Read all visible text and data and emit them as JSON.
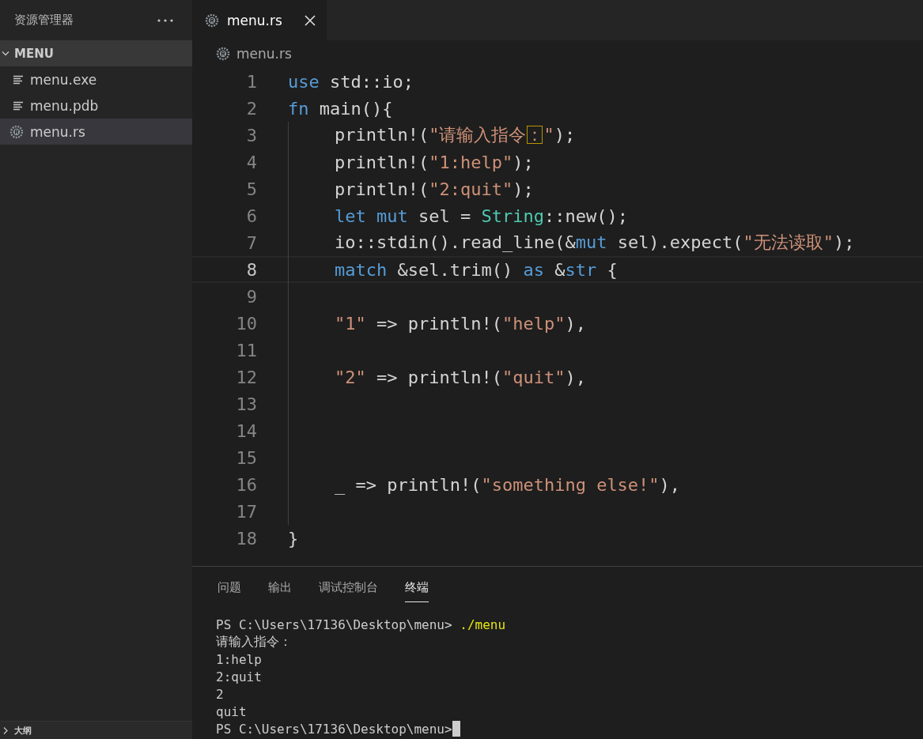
{
  "sidebar": {
    "title": "资源管理器",
    "folder": {
      "label": "MENU",
      "expanded": true
    },
    "files": [
      {
        "name": "menu.exe",
        "kind": "text",
        "selected": false
      },
      {
        "name": "menu.pdb",
        "kind": "text",
        "selected": false
      },
      {
        "name": "menu.rs",
        "kind": "rust",
        "selected": true
      }
    ],
    "outline": {
      "label": "大纲",
      "expanded": false
    }
  },
  "tabs": [
    {
      "label": "menu.rs",
      "kind": "rust",
      "selected": true
    }
  ],
  "breadcrumb": {
    "label": "menu.rs",
    "kind": "rust"
  },
  "code": [
    {
      "number": "1",
      "indented": false,
      "current": false,
      "tokens": [
        {
          "kind": "keyword",
          "text": "use"
        },
        {
          "kind": "plain",
          "text": " std::io;"
        }
      ]
    },
    {
      "number": "2",
      "indented": false,
      "current": false,
      "tokens": [
        {
          "kind": "keyword",
          "text": "fn"
        },
        {
          "kind": "plain",
          "text": " main(){"
        }
      ]
    },
    {
      "number": "3",
      "indented": true,
      "current": false,
      "tokens": [
        {
          "kind": "plain",
          "text": "println!("
        },
        {
          "kind": "string",
          "text": "\"请输入指令"
        },
        {
          "kind": "flagged",
          "text": "："
        },
        {
          "kind": "string",
          "text": "\""
        },
        {
          "kind": "plain",
          "text": ");"
        }
      ]
    },
    {
      "number": "4",
      "indented": true,
      "current": false,
      "tokens": [
        {
          "kind": "plain",
          "text": "println!("
        },
        {
          "kind": "string",
          "text": "\"1:help\""
        },
        {
          "kind": "plain",
          "text": ");"
        }
      ]
    },
    {
      "number": "5",
      "indented": true,
      "current": false,
      "tokens": [
        {
          "kind": "plain",
          "text": "println!("
        },
        {
          "kind": "string",
          "text": "\"2:quit\""
        },
        {
          "kind": "plain",
          "text": ");"
        }
      ]
    },
    {
      "number": "6",
      "indented": true,
      "current": false,
      "tokens": [
        {
          "kind": "keyword",
          "text": "let"
        },
        {
          "kind": "keyword",
          "text": " mut"
        },
        {
          "kind": "plain",
          "text": " sel = "
        },
        {
          "kind": "type",
          "text": "String"
        },
        {
          "kind": "plain",
          "text": "::new();"
        }
      ]
    },
    {
      "number": "7",
      "indented": true,
      "current": false,
      "tokens": [
        {
          "kind": "plain",
          "text": "io::stdin().read_line(&"
        },
        {
          "kind": "keyword",
          "text": "mut"
        },
        {
          "kind": "plain",
          "text": " sel).expect("
        },
        {
          "kind": "string",
          "text": "\"无法读取\""
        },
        {
          "kind": "plain",
          "text": ");"
        }
      ]
    },
    {
      "number": "8",
      "indented": true,
      "current": true,
      "tokens": [
        {
          "kind": "keyword",
          "text": "match"
        },
        {
          "kind": "plain",
          "text": " &sel.trim() "
        },
        {
          "kind": "keyword",
          "text": "as"
        },
        {
          "kind": "plain",
          "text": " &"
        },
        {
          "kind": "keyword",
          "text": "str"
        },
        {
          "kind": "plain",
          "text": " {"
        }
      ]
    },
    {
      "number": "9",
      "indented": true,
      "current": false
    },
    {
      "number": "10",
      "indented": true,
      "current": false,
      "tokens": [
        {
          "kind": "string",
          "text": "\"1\""
        },
        {
          "kind": "plain",
          "text": " => println!("
        },
        {
          "kind": "string",
          "text": "\"help\""
        },
        {
          "kind": "plain",
          "text": "),"
        }
      ]
    },
    {
      "number": "11",
      "indented": true,
      "current": false
    },
    {
      "number": "12",
      "indented": true,
      "current": false,
      "tokens": [
        {
          "kind": "string",
          "text": "\"2\""
        },
        {
          "kind": "plain",
          "text": " => println!("
        },
        {
          "kind": "string",
          "text": "\"quit\""
        },
        {
          "kind": "plain",
          "text": "),"
        }
      ]
    },
    {
      "number": "13",
      "indented": true,
      "current": false
    },
    {
      "number": "14",
      "indented": true,
      "current": false
    },
    {
      "number": "15",
      "indented": true,
      "current": false
    },
    {
      "number": "16",
      "indented": true,
      "current": false,
      "tokens": [
        {
          "kind": "plain",
          "text": "_ => println!("
        },
        {
          "kind": "string",
          "text": "\"something else!\""
        },
        {
          "kind": "plain",
          "text": "),"
        }
      ]
    },
    {
      "number": "17",
      "indented": true,
      "current": false
    },
    {
      "number": "18",
      "indented": false,
      "current": false,
      "tokens": [
        {
          "kind": "plain",
          "text": "}"
        }
      ]
    }
  ],
  "panel_tabs": [
    {
      "label": "问题",
      "selected": false
    },
    {
      "label": "输出",
      "selected": false
    },
    {
      "label": "调试控制台",
      "selected": false
    },
    {
      "label": "终端",
      "selected": true
    }
  ],
  "terminal": [
    {
      "cursor": false,
      "segments": [
        {
          "kind": "plain",
          "text": "PS C:\\Users\\17136\\Desktop\\menu> "
        },
        {
          "kind": "command",
          "text": "./menu"
        }
      ]
    },
    {
      "cursor": false,
      "segments": [
        {
          "kind": "plain",
          "text": "请输入指令："
        }
      ]
    },
    {
      "cursor": false,
      "segments": [
        {
          "kind": "plain",
          "text": "1:help"
        }
      ]
    },
    {
      "cursor": false,
      "segments": [
        {
          "kind": "plain",
          "text": "2:quit"
        }
      ]
    },
    {
      "cursor": false,
      "segments": [
        {
          "kind": "plain",
          "text": "2"
        }
      ]
    },
    {
      "cursor": false,
      "segments": [
        {
          "kind": "plain",
          "text": "quit"
        }
      ]
    },
    {
      "cursor": true,
      "segments": [
        {
          "kind": "plain",
          "text": "PS C:\\Users\\17136\\Desktop\\menu> "
        }
      ]
    }
  ]
}
